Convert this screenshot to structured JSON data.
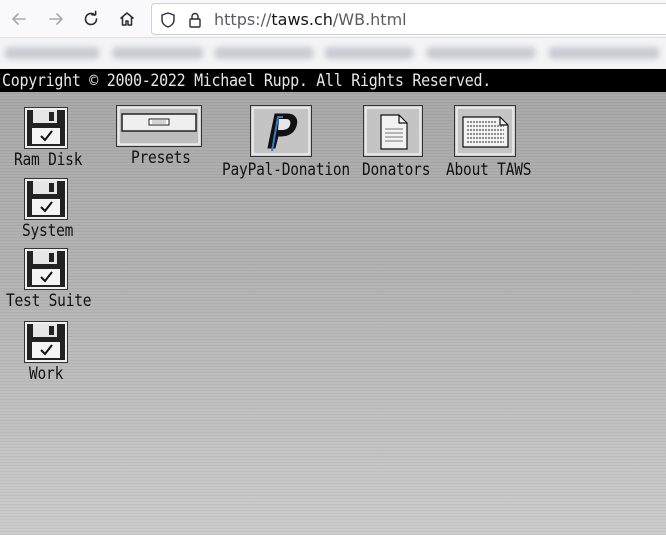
{
  "browser": {
    "url_prefix": "https://",
    "url_host": "taws.ch",
    "url_path": "/WB.html"
  },
  "workbench": {
    "copyright": "Copyright © 2000-2022 Michael Rupp. All Rights Reserved.",
    "disks": [
      {
        "label": "Ram Disk"
      },
      {
        "label": "System"
      },
      {
        "label": "Test Suite"
      },
      {
        "label": "Work"
      }
    ],
    "tools": [
      {
        "label": "Presets"
      },
      {
        "label": "PayPal-Donation"
      },
      {
        "label": "Donators"
      },
      {
        "label": "About TAWS"
      }
    ]
  }
}
